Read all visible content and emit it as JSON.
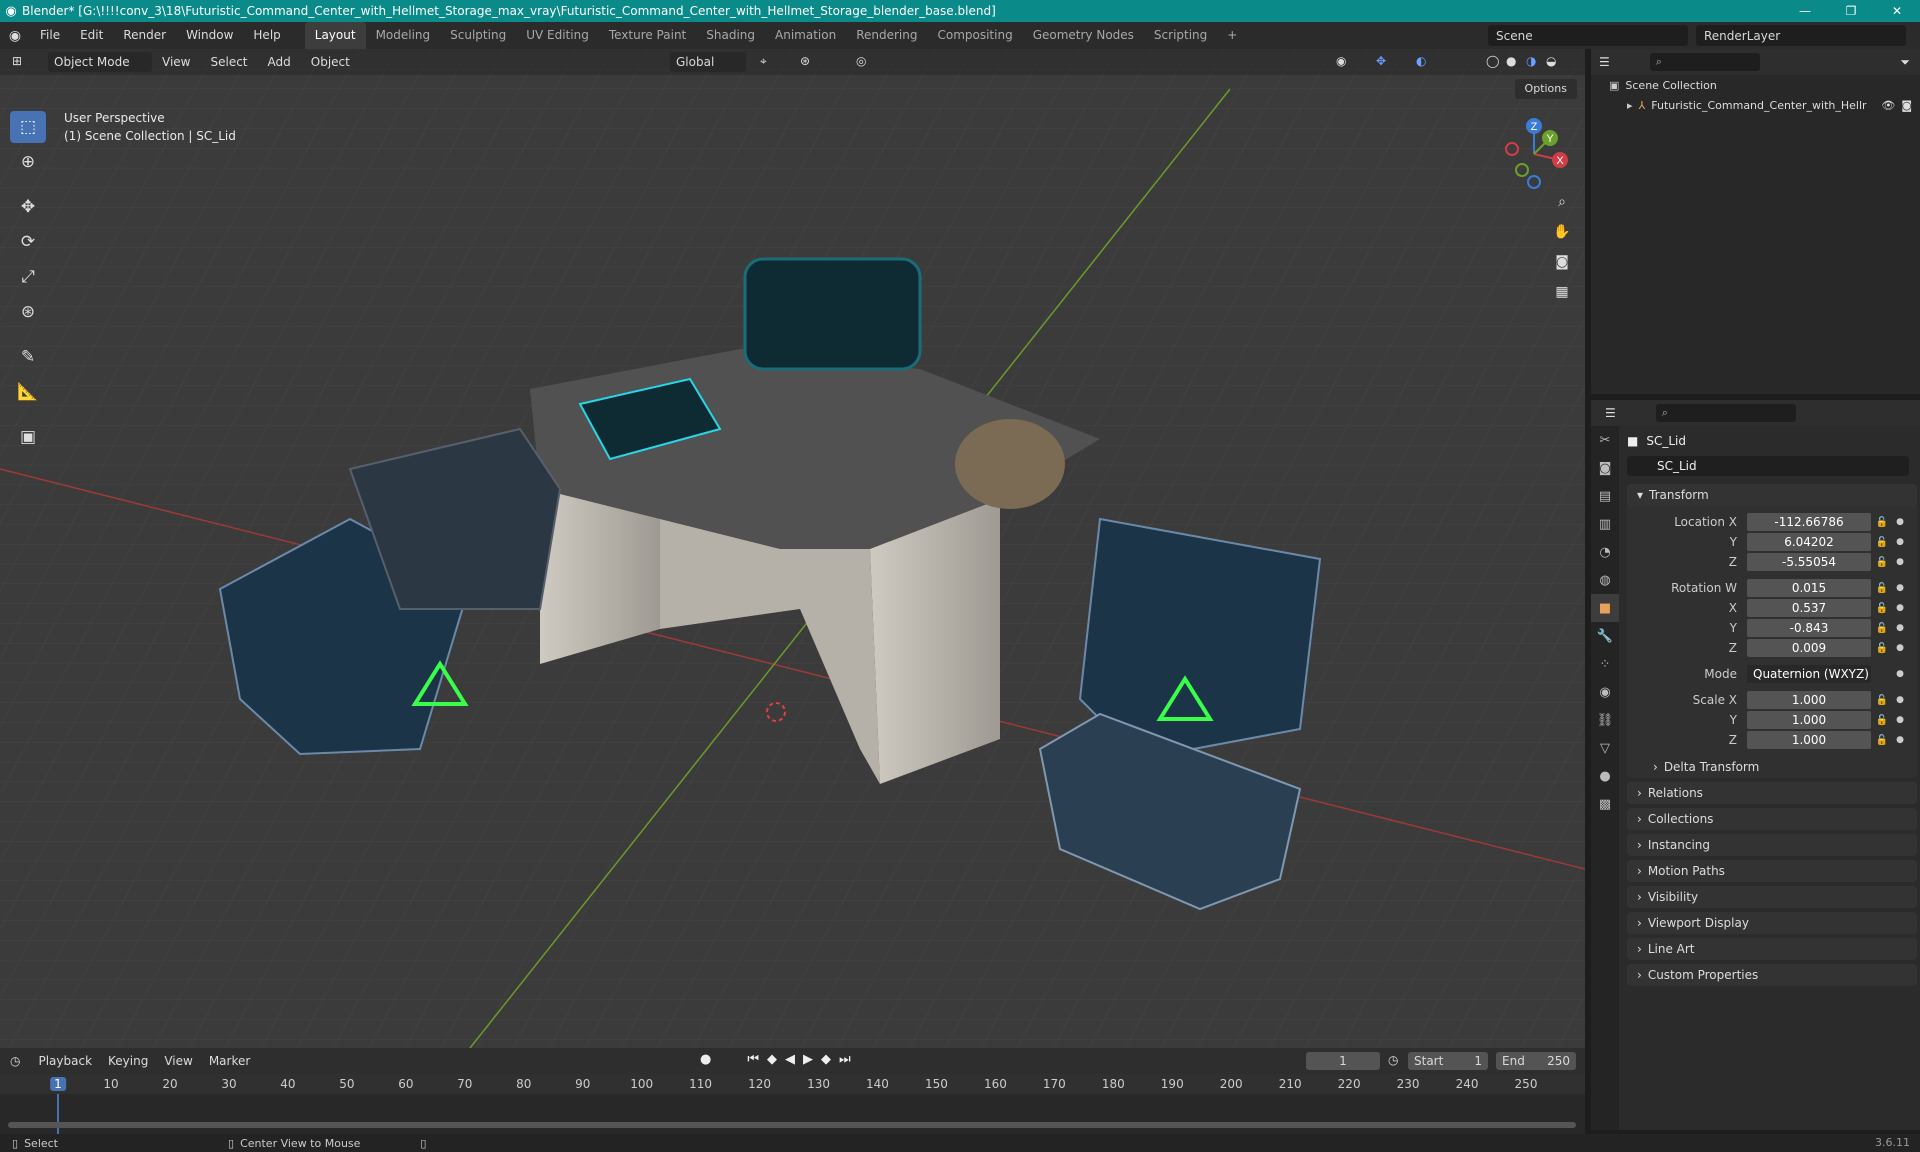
{
  "window": {
    "title": "Blender* [G:\\!!!!conv_3\\18\\Futuristic_Command_Center_with_Hellmet_Storage_max_vray\\Futuristic_Command_Center_with_Hellmet_Storage_blender_base.blend]"
  },
  "topbar": {
    "menus": [
      "File",
      "Edit",
      "Render",
      "Window",
      "Help"
    ],
    "workspaces": [
      "Layout",
      "Modeling",
      "Sculpting",
      "UV Editing",
      "Texture Paint",
      "Shading",
      "Animation",
      "Rendering",
      "Compositing",
      "Geometry Nodes",
      "Scripting"
    ],
    "active_workspace": "Layout",
    "scene": "Scene",
    "view_layer": "RenderLayer"
  },
  "viewport": {
    "mode": "Object Mode",
    "menus": [
      "View",
      "Select",
      "Add",
      "Object"
    ],
    "orientation": "Global",
    "options": "Options",
    "overlay_line1": "User Perspective",
    "overlay_line2": "(1) Scene Collection | SC_Lid",
    "gizmo_axes": [
      "X",
      "Y",
      "Z"
    ]
  },
  "outliner": {
    "root": "Scene Collection",
    "child": "Futuristic_Command_Center_with_Hellr"
  },
  "properties": {
    "object_name": "SC_Lid",
    "data_name": "SC_Lid",
    "transform_title": "Transform",
    "location_label": "Location X",
    "location": [
      "-112.66786",
      "6.04202",
      "-5.55054"
    ],
    "rotation_label": "Rotation W",
    "rotation": [
      "0.015",
      "0.537",
      "-0.843",
      "0.009"
    ],
    "mode_label": "Mode",
    "mode_value": "Quaternion (WXYZ)",
    "scale_label": "Scale X",
    "scale": [
      "1.000",
      "1.000",
      "1.000"
    ],
    "labels_y": "Y",
    "labels_z": "Z",
    "labels_x": "X",
    "delta": "Delta Transform",
    "panels": [
      "Relations",
      "Collections",
      "Instancing",
      "Motion Paths",
      "Visibility",
      "Viewport Display",
      "Line Art",
      "Custom Properties"
    ]
  },
  "timeline": {
    "menus": [
      "Playback",
      "Keying",
      "View",
      "Marker"
    ],
    "current_frame": "1",
    "start_label": "Start",
    "start": "1",
    "end_label": "End",
    "end": "250",
    "ticks": [
      "1",
      "10",
      "20",
      "30",
      "40",
      "50",
      "60",
      "70",
      "80",
      "90",
      "100",
      "110",
      "120",
      "130",
      "140",
      "150",
      "160",
      "170",
      "180",
      "190",
      "200",
      "210",
      "220",
      "230",
      "240",
      "250"
    ]
  },
  "statusbar": {
    "select": "Select",
    "center": "Center View to Mouse",
    "version": "3.6.11"
  },
  "colors": {
    "title_bg": "#0b8a8a",
    "accent": "#4772b3",
    "neon_green": "#39ff4a",
    "neon_cyan": "#27d7e6"
  }
}
